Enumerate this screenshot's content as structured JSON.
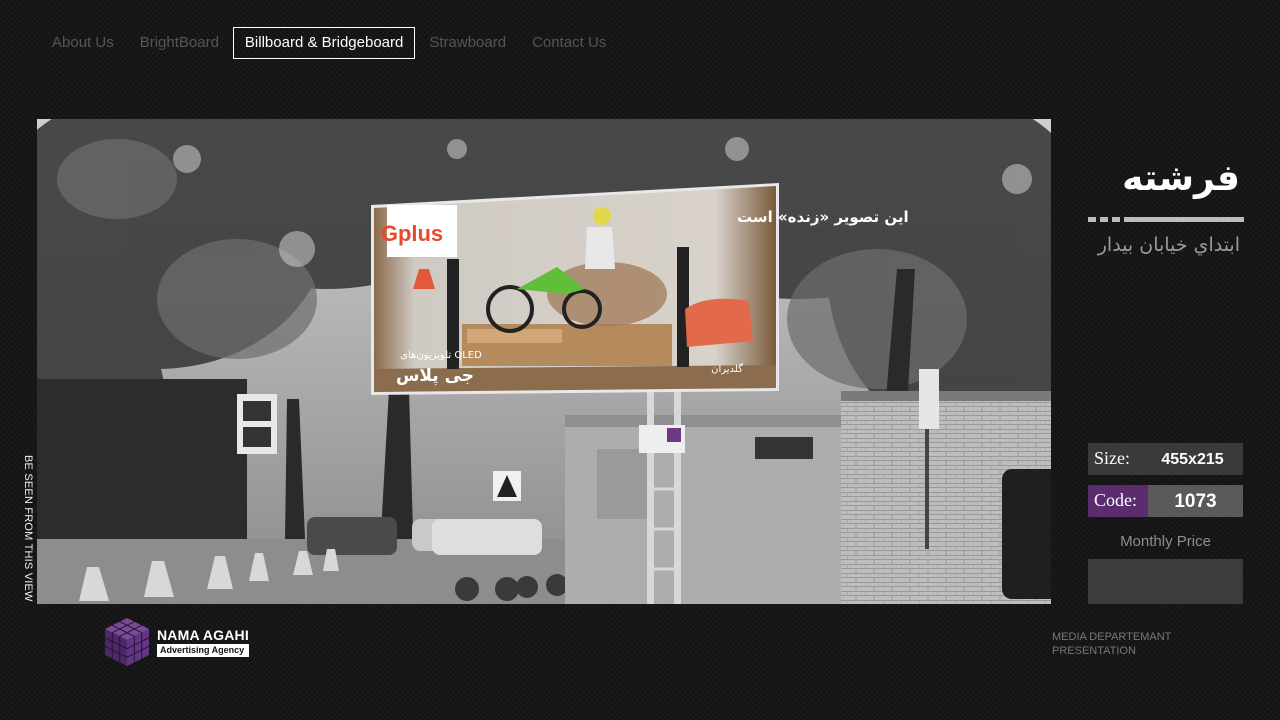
{
  "nav": {
    "items": [
      {
        "label": "About Us",
        "active": false
      },
      {
        "label": "BrightBoard",
        "active": false
      },
      {
        "label": "Billboard & Bridgeboard",
        "active": true
      },
      {
        "label": "Strawboard",
        "active": false
      },
      {
        "label": "Contact Us",
        "active": false
      }
    ]
  },
  "photo": {
    "side_caption": "BE SEEN FROM THIS VIEW",
    "billboard": {
      "brand": "Gplus",
      "headline": "این تصویر «زنده» است",
      "product_line": "تلویزیون‌های QLED",
      "brand_fa": "جی پلاس",
      "retailer": "گلدیران"
    }
  },
  "location": {
    "title": "فرشته",
    "subtitle": "ابتداي خيابان بيدار"
  },
  "specs": {
    "size_label": "Size:",
    "size_value": "455x215",
    "code_label": "Code:",
    "code_value": "1073",
    "price_label": "Monthly Price",
    "price_value": ""
  },
  "footer": {
    "logo_name": "NAMA AGAHI",
    "logo_tagline": "Advertising Agency",
    "note_line1": "MEDIA DEPARTEMANT",
    "note_line2": "PRESENTATION"
  },
  "colors": {
    "code_accent": "#5b2d6e",
    "logo_cube": "#5b2d6e",
    "active_nav_border": "#ffffff"
  }
}
